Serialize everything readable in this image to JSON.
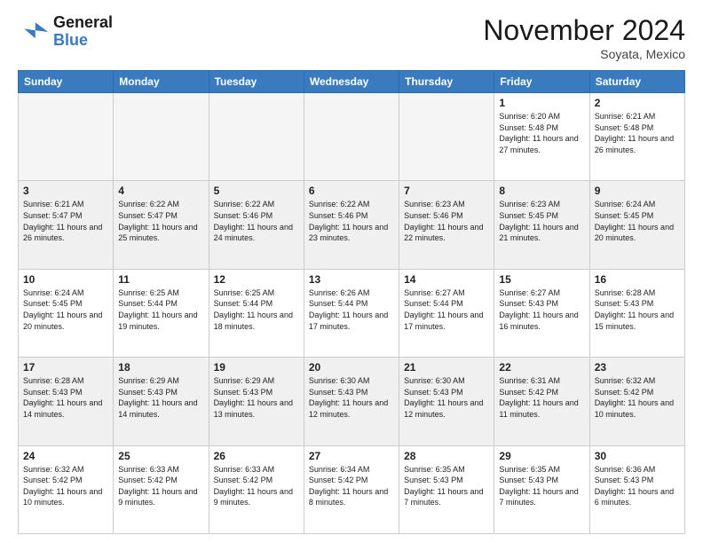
{
  "header": {
    "logo": {
      "general": "General",
      "blue": "Blue"
    },
    "month": "November 2024",
    "location": "Soyata, Mexico"
  },
  "weekdays": [
    "Sunday",
    "Monday",
    "Tuesday",
    "Wednesday",
    "Thursday",
    "Friday",
    "Saturday"
  ],
  "weeks": [
    [
      {
        "day": "",
        "empty": true
      },
      {
        "day": "",
        "empty": true
      },
      {
        "day": "",
        "empty": true
      },
      {
        "day": "",
        "empty": true
      },
      {
        "day": "",
        "empty": true
      },
      {
        "day": "1",
        "sunrise": "6:20 AM",
        "sunset": "5:48 PM",
        "daylight": "11 hours and 27 minutes."
      },
      {
        "day": "2",
        "sunrise": "6:21 AM",
        "sunset": "5:48 PM",
        "daylight": "11 hours and 26 minutes."
      }
    ],
    [
      {
        "day": "3",
        "sunrise": "6:21 AM",
        "sunset": "5:47 PM",
        "daylight": "11 hours and 26 minutes."
      },
      {
        "day": "4",
        "sunrise": "6:22 AM",
        "sunset": "5:47 PM",
        "daylight": "11 hours and 25 minutes."
      },
      {
        "day": "5",
        "sunrise": "6:22 AM",
        "sunset": "5:46 PM",
        "daylight": "11 hours and 24 minutes."
      },
      {
        "day": "6",
        "sunrise": "6:22 AM",
        "sunset": "5:46 PM",
        "daylight": "11 hours and 23 minutes."
      },
      {
        "day": "7",
        "sunrise": "6:23 AM",
        "sunset": "5:46 PM",
        "daylight": "11 hours and 22 minutes."
      },
      {
        "day": "8",
        "sunrise": "6:23 AM",
        "sunset": "5:45 PM",
        "daylight": "11 hours and 21 minutes."
      },
      {
        "day": "9",
        "sunrise": "6:24 AM",
        "sunset": "5:45 PM",
        "daylight": "11 hours and 20 minutes."
      }
    ],
    [
      {
        "day": "10",
        "sunrise": "6:24 AM",
        "sunset": "5:45 PM",
        "daylight": "11 hours and 20 minutes."
      },
      {
        "day": "11",
        "sunrise": "6:25 AM",
        "sunset": "5:44 PM",
        "daylight": "11 hours and 19 minutes."
      },
      {
        "day": "12",
        "sunrise": "6:25 AM",
        "sunset": "5:44 PM",
        "daylight": "11 hours and 18 minutes."
      },
      {
        "day": "13",
        "sunrise": "6:26 AM",
        "sunset": "5:44 PM",
        "daylight": "11 hours and 17 minutes."
      },
      {
        "day": "14",
        "sunrise": "6:27 AM",
        "sunset": "5:44 PM",
        "daylight": "11 hours and 17 minutes."
      },
      {
        "day": "15",
        "sunrise": "6:27 AM",
        "sunset": "5:43 PM",
        "daylight": "11 hours and 16 minutes."
      },
      {
        "day": "16",
        "sunrise": "6:28 AM",
        "sunset": "5:43 PM",
        "daylight": "11 hours and 15 minutes."
      }
    ],
    [
      {
        "day": "17",
        "sunrise": "6:28 AM",
        "sunset": "5:43 PM",
        "daylight": "11 hours and 14 minutes."
      },
      {
        "day": "18",
        "sunrise": "6:29 AM",
        "sunset": "5:43 PM",
        "daylight": "11 hours and 14 minutes."
      },
      {
        "day": "19",
        "sunrise": "6:29 AM",
        "sunset": "5:43 PM",
        "daylight": "11 hours and 13 minutes."
      },
      {
        "day": "20",
        "sunrise": "6:30 AM",
        "sunset": "5:43 PM",
        "daylight": "11 hours and 12 minutes."
      },
      {
        "day": "21",
        "sunrise": "6:30 AM",
        "sunset": "5:43 PM",
        "daylight": "11 hours and 12 minutes."
      },
      {
        "day": "22",
        "sunrise": "6:31 AM",
        "sunset": "5:42 PM",
        "daylight": "11 hours and 11 minutes."
      },
      {
        "day": "23",
        "sunrise": "6:32 AM",
        "sunset": "5:42 PM",
        "daylight": "11 hours and 10 minutes."
      }
    ],
    [
      {
        "day": "24",
        "sunrise": "6:32 AM",
        "sunset": "5:42 PM",
        "daylight": "11 hours and 10 minutes."
      },
      {
        "day": "25",
        "sunrise": "6:33 AM",
        "sunset": "5:42 PM",
        "daylight": "11 hours and 9 minutes."
      },
      {
        "day": "26",
        "sunrise": "6:33 AM",
        "sunset": "5:42 PM",
        "daylight": "11 hours and 9 minutes."
      },
      {
        "day": "27",
        "sunrise": "6:34 AM",
        "sunset": "5:42 PM",
        "daylight": "11 hours and 8 minutes."
      },
      {
        "day": "28",
        "sunrise": "6:35 AM",
        "sunset": "5:43 PM",
        "daylight": "11 hours and 7 minutes."
      },
      {
        "day": "29",
        "sunrise": "6:35 AM",
        "sunset": "5:43 PM",
        "daylight": "11 hours and 7 minutes."
      },
      {
        "day": "30",
        "sunrise": "6:36 AM",
        "sunset": "5:43 PM",
        "daylight": "11 hours and 6 minutes."
      }
    ]
  ],
  "labels": {
    "sunrise": "Sunrise:",
    "sunset": "Sunset:",
    "daylight": "Daylight: "
  }
}
